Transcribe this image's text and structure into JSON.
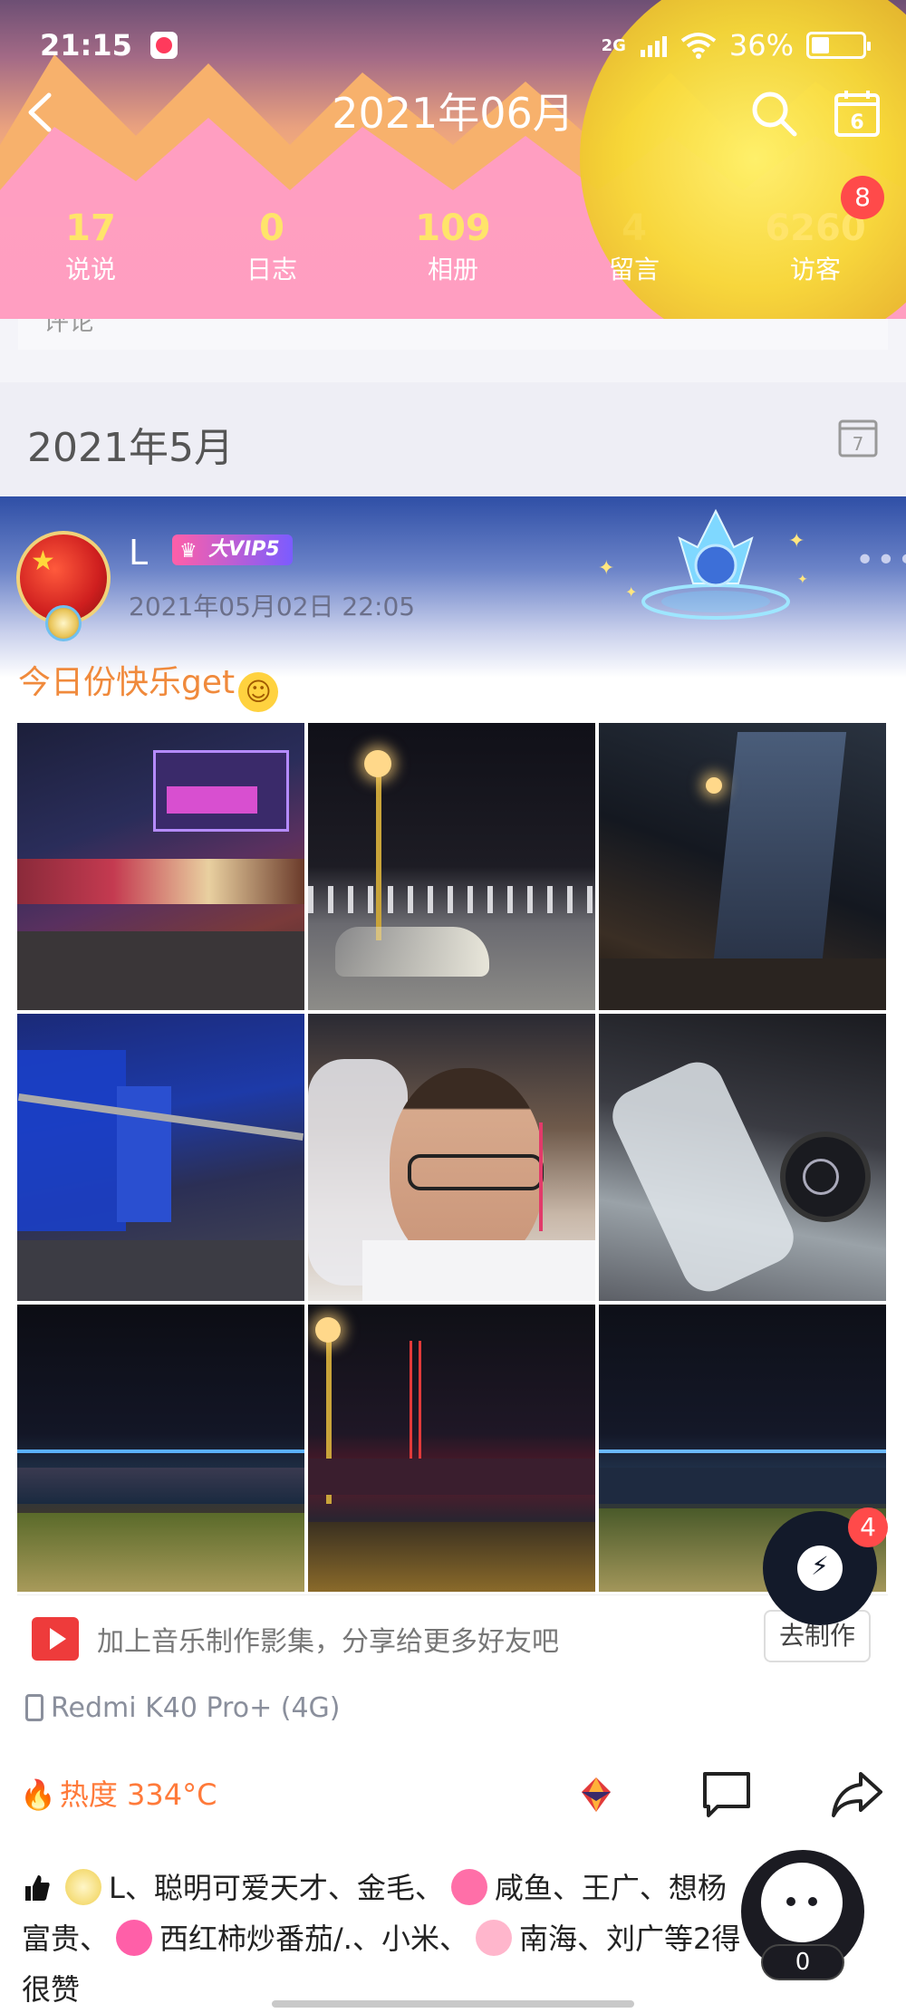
{
  "status_bar": {
    "time": "21:15",
    "network": "2G",
    "battery": "36%",
    "battery_level": 0.36
  },
  "nav": {
    "title": "2021年06月"
  },
  "stats": [
    {
      "value": "17",
      "label": "说说"
    },
    {
      "value": "0",
      "label": "日志"
    },
    {
      "value": "109",
      "label": "相册"
    },
    {
      "value": "4",
      "label": "留言"
    },
    {
      "value": "6260",
      "label": "访客",
      "badge": "8"
    }
  ],
  "prev_comment": "评论",
  "month_section": {
    "month": "2021年5月",
    "calendar_day": "7"
  },
  "header_calendar_day": "6",
  "post": {
    "username": "L",
    "vip": "大VIP5",
    "time": "2021年05月02日 22:05",
    "text": "今日份快乐get",
    "emoji": "😊",
    "photos": [
      "photo-1",
      "photo-2",
      "photo-3",
      "photo-4",
      "photo-5",
      "photo-6",
      "photo-7",
      "photo-8",
      "photo-9"
    ],
    "music_prompt": "加上音乐制作影集，分享给更多好友吧",
    "music_button": "去制作",
    "device": "Redmi K40 Pro+ (4G)",
    "heat": "热度 334°C"
  },
  "likes": {
    "line1_a": "L、聪明可爱天才、金毛、",
    "line1_b": "咸鱼、王广、想",
    "line1_c": "杨",
    "line2_a": "富贵、",
    "line2_b": "西红柿炒番茄/.、小米、",
    "line2_c": "南海、刘广等2",
    "line2_d": "得",
    "line3": "很赞"
  },
  "fab": {
    "badge": "4"
  },
  "mascot": {
    "count": "0"
  },
  "colors": {
    "accent_orange": "#f08a3c",
    "stat_yellow": "#ffe46a",
    "badge_red": "#ff4a4a",
    "header_pink": "#ff9ec1"
  }
}
